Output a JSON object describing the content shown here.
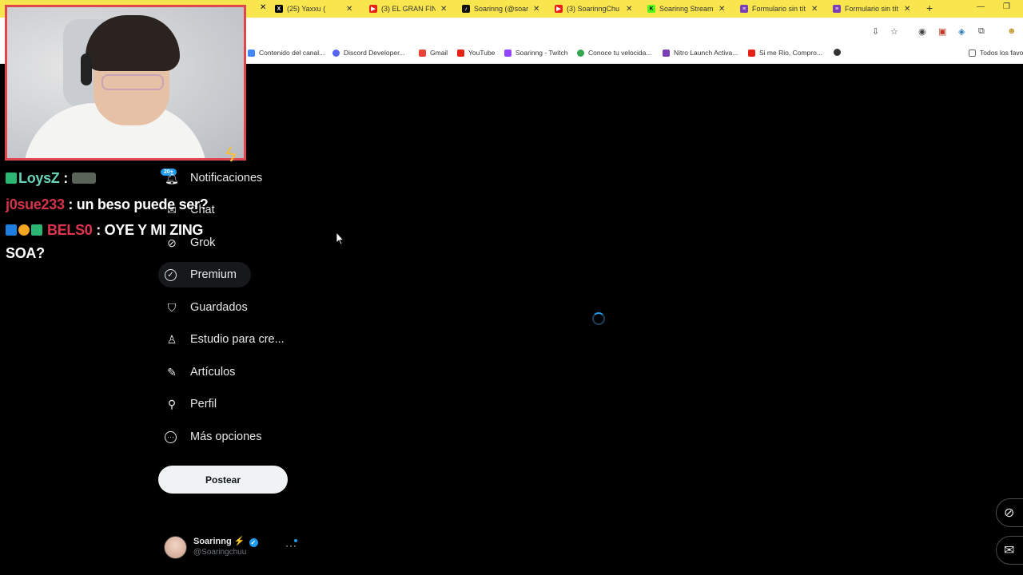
{
  "browser": {
    "tabs": [
      {
        "label": "(25) Yaxxu (",
        "icon": "x-icon",
        "color": "#000000",
        "glyph": "X"
      },
      {
        "label": "(3) EL GRAN FINA",
        "icon": "youtube-icon",
        "color": "#e62117",
        "glyph": "▶"
      },
      {
        "label": "Soarinng (@soari",
        "icon": "tiktok-icon",
        "color": "#111111",
        "glyph": "♪"
      },
      {
        "label": "(3) SoarinngChu",
        "icon": "youtube-icon",
        "color": "#e62117",
        "glyph": "▶"
      },
      {
        "label": "Soarinng Stream",
        "icon": "kick-icon",
        "color": "#53fc18",
        "glyph": "K"
      },
      {
        "label": "Formulario sin tít",
        "icon": "forms-icon",
        "color": "#7b3fb5",
        "glyph": "≡"
      },
      {
        "label": "Formulario sin tít",
        "icon": "forms-icon",
        "color": "#7b3fb5",
        "glyph": "≡"
      }
    ],
    "new_tab": "+",
    "bookmarks": [
      {
        "label": "Contenido del canal...",
        "color": "#4285f4"
      },
      {
        "label": "Discord Developer...",
        "color": "#5865f2"
      },
      {
        "label": "Gmail",
        "color": "#ea4335"
      },
      {
        "label": "YouTube",
        "color": "#e62117"
      },
      {
        "label": "Soarinng - Twitch",
        "color": "#9146ff"
      },
      {
        "label": "Conoce tu velocida...",
        "color": "#34a853"
      },
      {
        "label": "Nitro Launch Activa...",
        "color": "#7b3fb5"
      },
      {
        "label": "Si me Rio, Compro...",
        "color": "#e62117"
      }
    ],
    "all_bookmarks": "Todos los favo"
  },
  "chat": {
    "messages": [
      {
        "user": "LoysZ",
        "sep": " : ",
        "text": "",
        "user_color": "#67d3b7",
        "badges": [
          "#2bb673"
        ]
      },
      {
        "user": "j0sue233",
        "sep": " : ",
        "text": "un beso puede ser?",
        "user_color": "#d4334a",
        "badges": []
      },
      {
        "user": "BELS0",
        "sep": " : ",
        "text": "OYE Y MI ZING",
        "text2": "SOA?",
        "user_color": "#e0334f",
        "badges": [
          "#1d7fe0",
          "#f5a623",
          "#2bb673"
        ]
      }
    ]
  },
  "nav": {
    "notifications_badge": "20+",
    "items": [
      {
        "label": "Notificaciones",
        "icon": "bell-icon",
        "glyph": "🔔"
      },
      {
        "label": "Chat",
        "icon": "chat-icon",
        "glyph": "✉"
      },
      {
        "label": "Grok",
        "icon": "grok-icon",
        "glyph": "⊘"
      },
      {
        "label": "Premium",
        "icon": "premium-icon",
        "glyph": "✓"
      },
      {
        "label": "Guardados",
        "icon": "bookmark-icon",
        "glyph": "🔖"
      },
      {
        "label": "Estudio para cre...",
        "icon": "creator-studio-icon",
        "glyph": "♙"
      },
      {
        "label": "Artículos",
        "icon": "articles-icon",
        "glyph": "✎"
      },
      {
        "label": "Perfil",
        "icon": "profile-icon",
        "glyph": "👤"
      },
      {
        "label": "Más opciones",
        "icon": "more-options-icon",
        "glyph": "⋯"
      }
    ],
    "post_label": "Postear"
  },
  "account": {
    "name": "Soarinng",
    "name_emoji": "⚡",
    "handle": "@Soaringchuu",
    "more": "···"
  },
  "floating": {
    "grok_icon": "grok-icon",
    "messages_icon": "mail-icon"
  },
  "colors": {
    "background": "#000000",
    "accent": "#1d9bf0",
    "webcam_border": "#e0474c",
    "tabbar": "#f9e64f"
  }
}
